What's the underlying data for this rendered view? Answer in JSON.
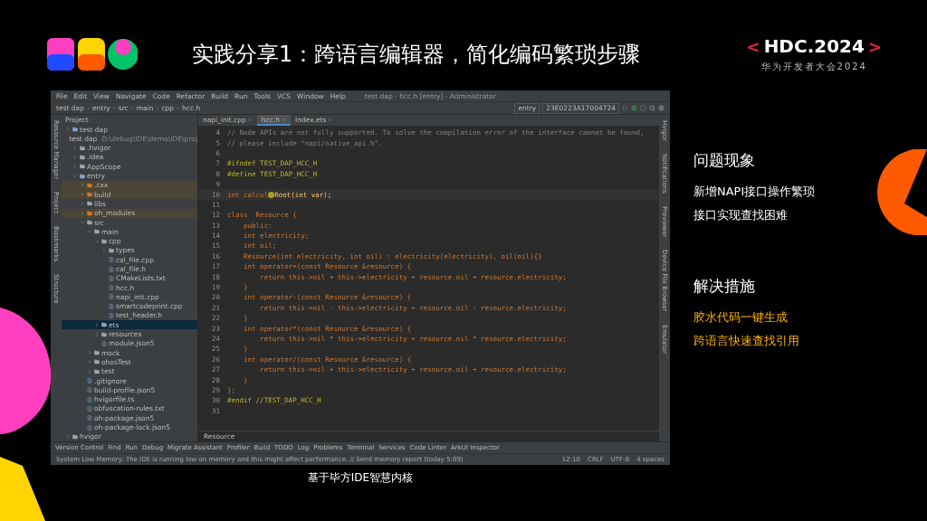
{
  "slide": {
    "title": "实践分享1：跨语言编辑器，简化编码繁琐步骤",
    "event_bracket_left": "<",
    "event_name": "HDC.2024",
    "event_bracket_right": ">",
    "event_subtitle": "华为开发者大会2024"
  },
  "ide": {
    "menu": [
      "File",
      "Edit",
      "View",
      "Navigate",
      "Code",
      "Refactor",
      "Build",
      "Run",
      "Tools",
      "VCS",
      "Window",
      "Help"
    ],
    "window_title": "test dap - hcc.h [entry] - Administrator",
    "breadcrumbs": [
      "test dap",
      "entry",
      "src",
      "main",
      "cpp",
      "hcc.h"
    ],
    "breadcrumb_separator": "›",
    "module": "entry",
    "device": "23E0223A17004724",
    "project_title": "Project",
    "left_strip": [
      "Resource Manager",
      "Project",
      "Bookmarks",
      "Structure"
    ],
    "right_strip": [
      "Hvigor",
      "Notifications",
      "Previewer",
      "Device File Browser",
      "Emulator"
    ],
    "tree": [
      {
        "label": "test dap",
        "kind": "module",
        "expanded": false,
        "selected": false,
        "marked": false
      },
      {
        "label": "test dap",
        "path": "D:\\debug\\IDE\\demo\\IDE\\proj",
        "kind": "module",
        "expanded": true,
        "selected": false,
        "marked": false,
        "children": [
          {
            "label": ".hvigor",
            "kind": "folder",
            "expanded": false,
            "selected": false,
            "marked": false
          },
          {
            "label": ".idea",
            "kind": "folder",
            "expanded": false,
            "selected": false,
            "marked": false
          },
          {
            "label": "AppScope",
            "kind": "folder",
            "expanded": false,
            "selected": false,
            "marked": false
          },
          {
            "label": "entry",
            "kind": "module",
            "expanded": true,
            "selected": false,
            "marked": false,
            "children": [
              {
                "label": ".cxx",
                "kind": "folder",
                "expanded": false,
                "selected": false,
                "marked": true
              },
              {
                "label": "build",
                "kind": "folder",
                "expanded": false,
                "selected": false,
                "marked": true
              },
              {
                "label": "libs",
                "kind": "folder",
                "expanded": false,
                "selected": false,
                "marked": false
              },
              {
                "label": "oh_modules",
                "kind": "folder",
                "expanded": false,
                "selected": false,
                "marked": true
              },
              {
                "label": "src",
                "kind": "folder",
                "expanded": true,
                "selected": false,
                "marked": false,
                "children": [
                  {
                    "label": "main",
                    "kind": "folder",
                    "expanded": true,
                    "selected": false,
                    "marked": false,
                    "children": [
                      {
                        "label": "cpp",
                        "kind": "folder",
                        "expanded": true,
                        "selected": false,
                        "marked": false,
                        "children": [
                          {
                            "label": "types",
                            "kind": "folder",
                            "expanded": false,
                            "selected": false,
                            "marked": false
                          },
                          {
                            "label": "cal_file.cpp",
                            "kind": "file",
                            "selected": false,
                            "marked": false
                          },
                          {
                            "label": "cal_file.h",
                            "kind": "file",
                            "selected": false,
                            "marked": false
                          },
                          {
                            "label": "CMakeLists.txt",
                            "kind": "file",
                            "selected": false,
                            "marked": false
                          },
                          {
                            "label": "hcc.h",
                            "kind": "file",
                            "selected": false,
                            "marked": false
                          },
                          {
                            "label": "napi_init.cpp",
                            "kind": "file",
                            "selected": false,
                            "marked": false
                          },
                          {
                            "label": "smartcodeprint.cpp",
                            "kind": "file",
                            "selected": false,
                            "marked": false
                          },
                          {
                            "label": "test_header.h",
                            "kind": "file",
                            "selected": false,
                            "marked": false
                          }
                        ]
                      },
                      {
                        "label": "ets",
                        "kind": "folder",
                        "expanded": false,
                        "selected": true,
                        "marked": false
                      },
                      {
                        "label": "resources",
                        "kind": "folder",
                        "expanded": false,
                        "selected": false,
                        "marked": false
                      },
                      {
                        "label": "module.json5",
                        "kind": "file",
                        "selected": false,
                        "marked": false
                      }
                    ]
                  },
                  {
                    "label": "mock",
                    "kind": "folder",
                    "expanded": false,
                    "selected": false,
                    "marked": false
                  },
                  {
                    "label": "ohosTest",
                    "kind": "folder",
                    "expanded": false,
                    "selected": false,
                    "marked": false
                  },
                  {
                    "label": "test",
                    "kind": "folder",
                    "expanded": false,
                    "selected": false,
                    "marked": false
                  }
                ]
              },
              {
                "label": ".gitignore",
                "kind": "file",
                "selected": false,
                "marked": false
              },
              {
                "label": "build-profile.json5",
                "kind": "file",
                "selected": false,
                "marked": false
              },
              {
                "label": "hvigorfile.ts",
                "kind": "file",
                "selected": false,
                "marked": false
              },
              {
                "label": "obfuscation-rules.txt",
                "kind": "file",
                "selected": false,
                "marked": false
              },
              {
                "label": "oh-package.json5",
                "kind": "file",
                "selected": false,
                "marked": false
              },
              {
                "label": "oh-package-lock.json5",
                "kind": "file",
                "selected": false,
                "marked": false
              }
            ]
          }
        ]
      },
      {
        "label": "hvigor",
        "kind": "folder",
        "expanded": false,
        "selected": false,
        "marked": false
      }
    ],
    "tabs": [
      {
        "label": "napi_init.cpp",
        "selected": false
      },
      {
        "label": "hcc.h",
        "selected": true
      },
      {
        "label": "Index.ets",
        "selected": false
      }
    ],
    "code_lines": [
      {
        "num": "4",
        "kind": "comment",
        "text": "// Node APIs are not fully supported. To solve the compilation error of the interface cannot be found,"
      },
      {
        "num": "5",
        "kind": "comment",
        "text": "// please include \"napi/native_api.h\"."
      },
      {
        "num": "6",
        "kind": "blank"
      },
      {
        "num": "7",
        "kind": "directive",
        "text": "#ifndef TEST_DAP_HCC_H"
      },
      {
        "num": "8",
        "kind": "directive",
        "text": "#define TEST_DAP_HCC_H"
      },
      {
        "num": "9",
        "kind": "blank"
      },
      {
        "num": "10",
        "kind": "cursor",
        "text": "int calcul",
        "text_after": "Root(int var);"
      },
      {
        "num": "11",
        "kind": "blank"
      },
      {
        "num": "12",
        "kind": "code",
        "text": "class  Resource {"
      },
      {
        "num": "13",
        "kind": "code",
        "text": "    public:"
      },
      {
        "num": "14",
        "kind": "code",
        "text": "    int electricity;"
      },
      {
        "num": "15",
        "kind": "code",
        "text": "    int oil;"
      },
      {
        "num": "16",
        "kind": "code",
        "text": "    Resource(int electricity, int oil) : electricity(electricity), oil(oil){}"
      },
      {
        "num": "17",
        "kind": "code",
        "text": "    int operator+(const Resource &resource) {"
      },
      {
        "num": "18",
        "kind": "code",
        "text": "        return this->oil + this->electricity + resource.oil + resource.electricity;"
      },
      {
        "num": "19",
        "kind": "code",
        "text": "    }"
      },
      {
        "num": "20",
        "kind": "code",
        "text": "    int operator-(const Resource &resource) {"
      },
      {
        "num": "21",
        "kind": "code",
        "text": "        return this->oil - this->electricity + resource.oil - resource.electricity;"
      },
      {
        "num": "22",
        "kind": "code",
        "text": "    }"
      },
      {
        "num": "23",
        "kind": "code",
        "text": "    int operator*(const Resource &resource) {"
      },
      {
        "num": "24",
        "kind": "code",
        "text": "        return this->oil * this->electricity + resource.oil * resource.electricity;"
      },
      {
        "num": "25",
        "kind": "code",
        "text": "    }"
      },
      {
        "num": "26",
        "kind": "code",
        "text": "    int operator/(const Resource &resource) {"
      },
      {
        "num": "27",
        "kind": "code",
        "text": "        return this->oil + this->electricity + resource.oil + resource.electricity;"
      },
      {
        "num": "28",
        "kind": "code",
        "text": "    }"
      },
      {
        "num": "29",
        "kind": "code",
        "text": "};"
      },
      {
        "num": "30",
        "kind": "directive",
        "text": "#endif //TEST_DAP_HCC_H"
      },
      {
        "num": "31",
        "kind": "blank"
      }
    ],
    "editor_breadcrumb": "Resource",
    "tool_tabs": [
      "Version Control",
      "Find",
      "Run",
      "Debug",
      "Migrate Assistant",
      "Profiler",
      "Build",
      "TODO",
      "Log",
      "Problems",
      "Terminal",
      "Services",
      "Code Linter",
      "ArkUI Inspector"
    ],
    "status_message": "System Low Memory: The IDE is running low on memory and this might affect performance. // Send memory report (today 5:09)",
    "status_items": [
      "12:10",
      "CRLF",
      "UTF-8",
      "4 spaces"
    ]
  },
  "caption": "基于毕方IDE智慧内核",
  "problem": {
    "heading": "问题现象",
    "items": [
      "新增NAPI接口操作繁琐",
      "接口实现查找困难"
    ]
  },
  "solution": {
    "heading": "解决措施",
    "items": [
      "胶水代码一键生成",
      "跨语言快速查找引用"
    ]
  }
}
